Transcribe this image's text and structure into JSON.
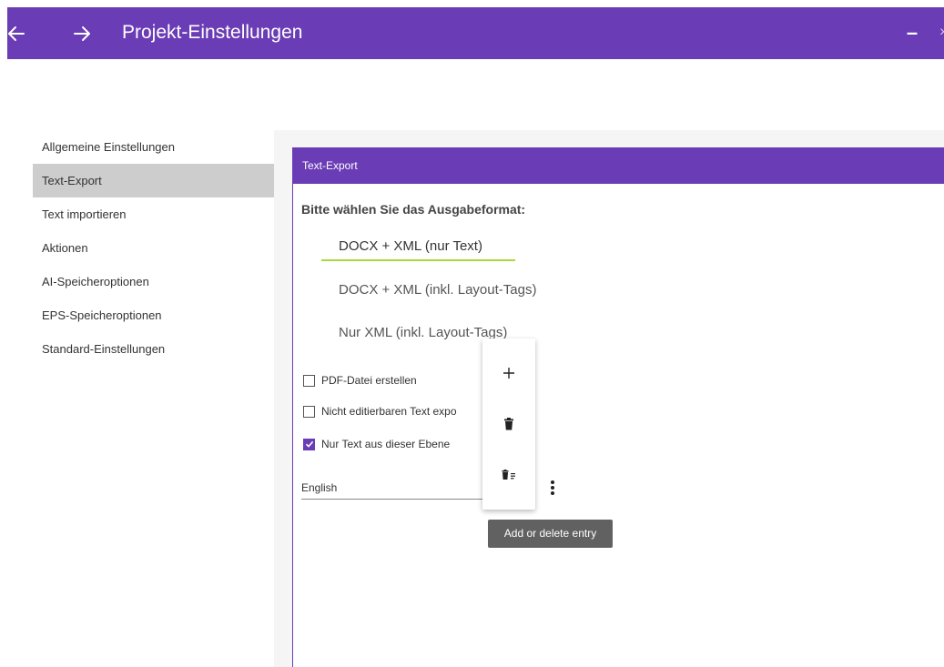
{
  "window": {
    "title": "Projekt-Einstellungen",
    "back_icon": "arrow-left-icon",
    "forward_icon": "arrow-right-icon",
    "minimize_label": "–",
    "close_label": "×",
    "accent": "#6a3cb5"
  },
  "sidebar": {
    "items": [
      {
        "label": "Allgemeine Einstellungen",
        "active": false
      },
      {
        "label": "Text-Export",
        "active": true
      },
      {
        "label": "Text importieren",
        "active": false
      },
      {
        "label": "Aktionen",
        "active": false
      },
      {
        "label": "AI-Speicheroptionen",
        "active": false
      },
      {
        "label": "EPS-Speicheroptionen",
        "active": false
      },
      {
        "label": "Standard-Einstellungen",
        "active": false
      }
    ]
  },
  "panel": {
    "header": "Text-Export",
    "prompt": "Bitte wählen Sie das Ausgabeformat:",
    "formats": [
      {
        "label": "DOCX + XML (nur Text)",
        "selected": true
      },
      {
        "label": "DOCX + XML (inkl. Layout-Tags)",
        "selected": false
      },
      {
        "label": "Nur XML (inkl. Layout-Tags)",
        "selected": false
      }
    ],
    "checkboxes": [
      {
        "label": "PDF-Datei erstellen",
        "checked": false
      },
      {
        "label": "Nicht editierbaren Text expo",
        "checked": false
      },
      {
        "label": "Nur Text aus dieser Ebene",
        "checked": true
      }
    ],
    "language": "English"
  },
  "popup_menu": {
    "items": [
      {
        "icon": "plus-icon"
      },
      {
        "icon": "trash-icon"
      },
      {
        "icon": "delete-list-icon"
      }
    ],
    "tooltip": "Add or delete entry"
  }
}
